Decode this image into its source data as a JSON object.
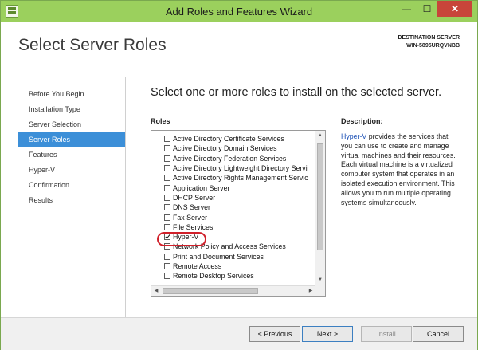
{
  "window": {
    "title": "Add Roles and Features Wizard",
    "minimize": "—",
    "maximize": "☐",
    "close": "✕"
  },
  "header": {
    "title": "Select Server Roles",
    "destination_label": "DESTINATION SERVER",
    "destination_value": "WIN-5895URQVNBB"
  },
  "sidebar": {
    "items": [
      {
        "label": "Before You Begin",
        "active": false
      },
      {
        "label": "Installation Type",
        "active": false
      },
      {
        "label": "Server Selection",
        "active": false
      },
      {
        "label": "Server Roles",
        "active": true
      },
      {
        "label": "Features",
        "active": false
      },
      {
        "label": "Hyper-V",
        "active": false
      },
      {
        "label": "Confirmation",
        "active": false
      },
      {
        "label": "Results",
        "active": false
      }
    ]
  },
  "main": {
    "instruction": "Select one or more roles to install on the selected server.",
    "roles_label": "Roles",
    "roles": [
      {
        "label": "Active Directory Certificate Services",
        "checked": false
      },
      {
        "label": "Active Directory Domain Services",
        "checked": false
      },
      {
        "label": "Active Directory Federation Services",
        "checked": false
      },
      {
        "label": "Active Directory Lightweight Directory Servi",
        "checked": false
      },
      {
        "label": "Active Directory Rights Management Servic",
        "checked": false
      },
      {
        "label": "Application Server",
        "checked": false
      },
      {
        "label": "DHCP Server",
        "checked": false
      },
      {
        "label": "DNS Server",
        "checked": false
      },
      {
        "label": "Fax Server",
        "checked": false
      },
      {
        "label": "File Services",
        "checked": false
      },
      {
        "label": "Hyper-V",
        "checked": true
      },
      {
        "label": "Network Policy and Access Services",
        "checked": false
      },
      {
        "label": "Print and Document Services",
        "checked": false
      },
      {
        "label": "Remote Access",
        "checked": false
      },
      {
        "label": "Remote Desktop Services",
        "checked": false
      }
    ],
    "description_label": "Description:",
    "description_link": "Hyper-V",
    "description_text": " provides the services that you can use to create and manage virtual machines and their resources. Each virtual machine is a virtualized computer system that operates in an isolated execution environment. This allows you to run multiple operating systems simultaneously."
  },
  "footer": {
    "previous": "< Previous",
    "next": "Next >",
    "install": "Install",
    "cancel": "Cancel"
  },
  "colors": {
    "titlebar": "#9bd05d",
    "active_nav": "#3c8fd8",
    "highlight_ring": "#d0202a"
  }
}
